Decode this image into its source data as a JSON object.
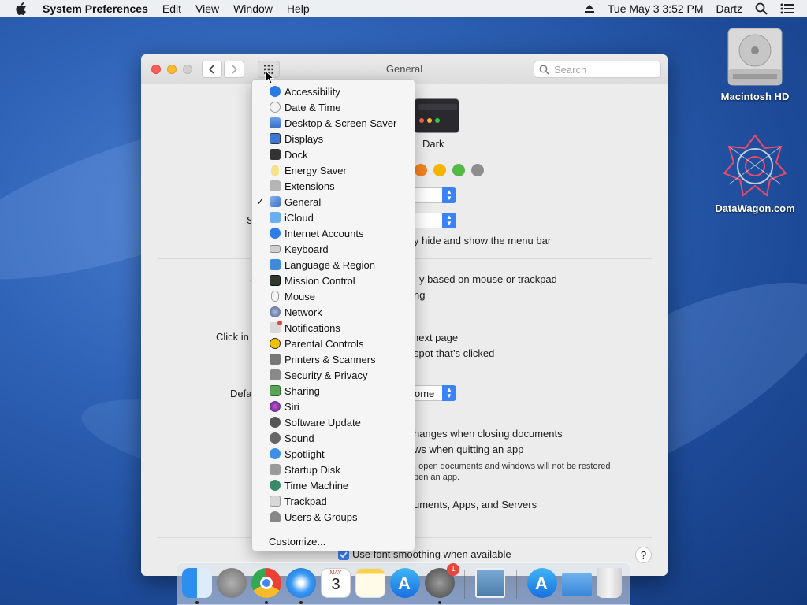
{
  "menubar": {
    "app_name": "System Preferences",
    "items": [
      "Edit",
      "View",
      "Window",
      "Help"
    ],
    "clock": "Tue May 3  3:52 PM",
    "user": "Dartz"
  },
  "desktop": {
    "icons": [
      {
        "label": "Macintosh HD"
      },
      {
        "label": "DataWagon.com"
      }
    ]
  },
  "window": {
    "title": "General",
    "search_placeholder": "Search",
    "appearance_dark_label": "Dark",
    "partial_texts": {
      "s_label": "S",
      "hide_menu": "y hide and show the menu bar",
      "s2_label": "S",
      "scroll_based": "y based on mouse or trackpad",
      "scroll_ng": "ng",
      "click_in": "Click in",
      "next_page": "next page",
      "spot_clicked": "spot that’s clicked",
      "defa": "Defa",
      "browser_value": "ome",
      "changes_closing": "hanges when closing documents",
      "quit_app": "ws when quitting an app",
      "note_line1": ", open documents and windows will not be restored",
      "note_line2": "pen an app.",
      "recent_items": "uments, Apps, and Servers"
    },
    "font_smoothing_label": "Use font smoothing when available",
    "help_label": "?"
  },
  "menu": {
    "items": [
      {
        "label": "Accessibility",
        "icon": "accessibility-icon",
        "color": "#2a7be4"
      },
      {
        "label": "Date & Time",
        "icon": "date-time-icon",
        "color": "#e8e8e8"
      },
      {
        "label": "Desktop & Screen Saver",
        "icon": "desktop-icon",
        "color": "#4b7ed6"
      },
      {
        "label": "Displays",
        "icon": "displays-icon",
        "color": "#3c78d8"
      },
      {
        "label": "Dock",
        "icon": "dock-icon",
        "color": "#333333"
      },
      {
        "label": "Energy Saver",
        "icon": "energy-saver-icon",
        "color": "#f4e38a"
      },
      {
        "label": "Extensions",
        "icon": "extensions-icon",
        "color": "#a9a9a9"
      },
      {
        "label": "General",
        "icon": "general-icon",
        "color": "#5b8fd8",
        "checked": true
      },
      {
        "label": "iCloud",
        "icon": "icloud-icon",
        "color": "#6aaef0"
      },
      {
        "label": "Internet Accounts",
        "icon": "internet-accounts-icon",
        "color": "#2f7ee6"
      },
      {
        "label": "Keyboard",
        "icon": "keyboard-icon",
        "color": "#bdbdbd"
      },
      {
        "label": "Language & Region",
        "icon": "language-region-icon",
        "color": "#3f8bd8"
      },
      {
        "label": "Mission Control",
        "icon": "mission-control-icon",
        "color": "#2e3a2e"
      },
      {
        "label": "Mouse",
        "icon": "mouse-icon",
        "color": "#f0f0f0"
      },
      {
        "label": "Network",
        "icon": "network-icon",
        "color": "#6a7fa8"
      },
      {
        "label": "Notifications",
        "icon": "notifications-icon",
        "color": "#d9d9d9"
      },
      {
        "label": "Parental Controls",
        "icon": "parental-controls-icon",
        "color": "#f2c200"
      },
      {
        "label": "Printers & Scanners",
        "icon": "printers-icon",
        "color": "#777777"
      },
      {
        "label": "Security & Privacy",
        "icon": "security-icon",
        "color": "#8a8a8a"
      },
      {
        "label": "Sharing",
        "icon": "sharing-icon",
        "color": "#5aa45a"
      },
      {
        "label": "Siri",
        "icon": "siri-icon",
        "color": "#4b3aa8"
      },
      {
        "label": "Software Update",
        "icon": "software-update-icon",
        "color": "#555555"
      },
      {
        "label": "Sound",
        "icon": "sound-icon",
        "color": "#666666"
      },
      {
        "label": "Spotlight",
        "icon": "spotlight-icon",
        "color": "#3d8ee6"
      },
      {
        "label": "Startup Disk",
        "icon": "startup-disk-icon",
        "color": "#9a9a9a"
      },
      {
        "label": "Time Machine",
        "icon": "time-machine-icon",
        "color": "#3a8a6a"
      },
      {
        "label": "Trackpad",
        "icon": "trackpad-icon",
        "color": "#cfcfcf"
      },
      {
        "label": "Users & Groups",
        "icon": "users-groups-icon",
        "color": "#888888"
      }
    ],
    "customize_label": "Customize..."
  },
  "dock": {
    "calendar_month": "MAY",
    "calendar_day": "3",
    "badge": "1",
    "apps": [
      "finder-icon",
      "launchpad-icon",
      "chrome-icon",
      "safari-icon",
      "calendar-icon",
      "notes-icon",
      "app-store-icon",
      "system-preferences-icon",
      "preview-icon",
      "applications-folder-icon",
      "downloads-folder-icon",
      "trash-icon"
    ]
  },
  "accent_colors": [
    "#f5841f",
    "#f4b400",
    "#55b947",
    "#8e8e8e"
  ]
}
